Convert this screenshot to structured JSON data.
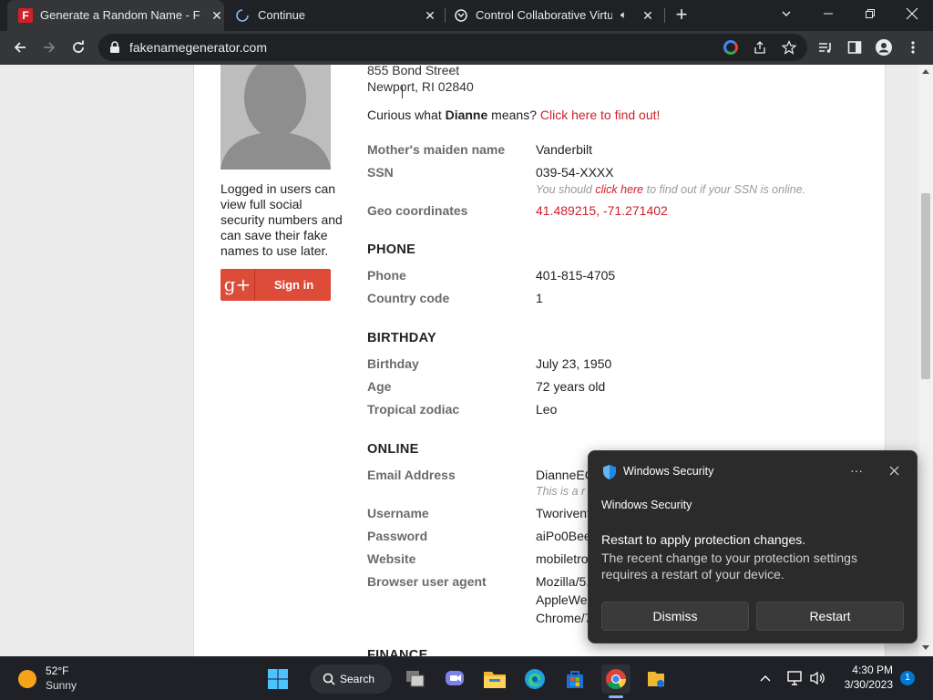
{
  "browser": {
    "tabs": [
      {
        "title": "Generate a Random Name - Fake",
        "favicon": "F",
        "active": true
      },
      {
        "title": "Continue",
        "loading": true
      },
      {
        "title": "Control Collaborative Virtual",
        "audio": true
      }
    ],
    "new_tab_label": "+",
    "url": "fakenamegenerator.com"
  },
  "page": {
    "login_note": [
      "Logged in users can",
      "view full social",
      "security numbers and",
      "can save their fake",
      "names to use later."
    ],
    "signin_label": "Sign in",
    "gplus_label": "g+",
    "address": {
      "line1": "855 Bond Street",
      "line2": "Newport, RI 02840"
    },
    "curious": {
      "prefix": "Curious what ",
      "name": "Dianne",
      "middle": " means? ",
      "link": "Click here to find out!"
    },
    "identity": [
      {
        "label": "Mother's maiden name",
        "value": "Vanderbilt"
      },
      {
        "label": "SSN",
        "value": "039-54-XXXX"
      },
      {
        "label": "Geo coordinates",
        "value": "41.489215, -71.271402"
      }
    ],
    "ssn_note": {
      "prefix": "You should ",
      "link": "click here",
      "suffix": " to find out if your SSN is online."
    },
    "phone": {
      "heading": "PHONE",
      "rows": [
        {
          "label": "Phone",
          "value": "401-815-4705"
        },
        {
          "label": "Country code",
          "value": "1"
        }
      ]
    },
    "birthday": {
      "heading": "BIRTHDAY",
      "rows": [
        {
          "label": "Birthday",
          "value": "July 23, 1950"
        },
        {
          "label": "Age",
          "value": "72 years old"
        },
        {
          "label": "Tropical zodiac",
          "value": "Leo"
        }
      ]
    },
    "online": {
      "heading": "ONLINE",
      "rows": [
        {
          "label": "Email Address",
          "value": "DianneEC"
        },
        {
          "label": "Username",
          "value": "Tworivent"
        },
        {
          "label": "Password",
          "value": "aiPo0Bee"
        },
        {
          "label": "Website",
          "value": "mobiletro"
        },
        {
          "label": "Browser user agent",
          "value": "Mozilla/5."
        }
      ],
      "email_note": "This is a r",
      "agent_line2": "AppleWeb",
      "agent_line3": "Chrome/7"
    },
    "finance_heading": "FINANCE"
  },
  "toast": {
    "app": "Windows Security",
    "subtitle": "Windows Security",
    "title": "Restart to apply protection changes.",
    "body_line1": "The recent change to your protection settings",
    "body_line2": "requires a restart of your device.",
    "dismiss": "Dismiss",
    "restart": "Restart",
    "more": "···"
  },
  "taskbar": {
    "weather_temp": "52°F",
    "weather_desc": "Sunny",
    "search_label": "Search",
    "time": "4:30 PM",
    "date": "3/30/2023",
    "notification_count": "1"
  },
  "colors": {
    "accent_red": "#d0202a",
    "gplus_red": "#dd4b39",
    "windows_blue": "#0078d4"
  }
}
